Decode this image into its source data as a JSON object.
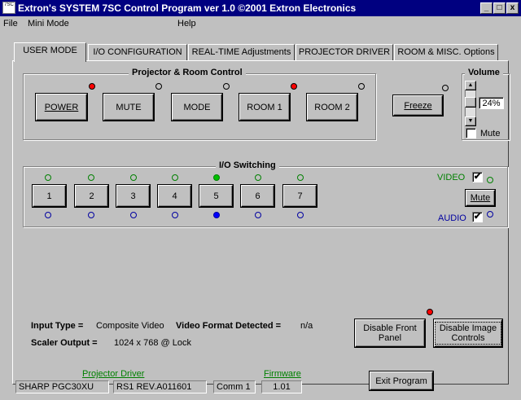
{
  "window": {
    "title": "Extron's SYSTEM 7SC Control Program    ver 1.0   ©2001 Extron Electronics",
    "icon_text": "7SC",
    "min_label": "_",
    "max_label": "□",
    "close_label": "x"
  },
  "menu": {
    "file": "File",
    "mini_mode": "Mini Mode",
    "help": "Help"
  },
  "tabs": [
    {
      "label": "USER MODE"
    },
    {
      "label": "I/O CONFIGURATION"
    },
    {
      "label": "REAL-TIME Adjustments"
    },
    {
      "label": "PROJECTOR DRIVER"
    },
    {
      "label": "ROOM & MISC. Options"
    }
  ],
  "projector_control": {
    "title": "Projector & Room Control",
    "buttons": [
      {
        "label": "POWER",
        "led": "red"
      },
      {
        "label": "MUTE",
        "led": "off"
      },
      {
        "label": "MODE",
        "led": "off"
      },
      {
        "label": "ROOM 1",
        "led": "red"
      },
      {
        "label": "ROOM 2",
        "led": "off"
      }
    ],
    "freeze_label": "Freeze",
    "freeze_led": "off"
  },
  "volume": {
    "title": "Volume",
    "value_text": "24%",
    "level": 0.24,
    "mute_label": "Mute",
    "mute_checked": false
  },
  "io_switching": {
    "title": "I/O Switching",
    "inputs": [
      "1",
      "2",
      "3",
      "4",
      "5",
      "6",
      "7"
    ],
    "active_input": "5",
    "video_label": "VIDEO",
    "audio_label": "AUDIO",
    "video_checked": true,
    "audio_checked": true,
    "check_mark": "✔",
    "mute_label": "Mute",
    "colors": {
      "video": "#008000",
      "audio": "#0000a0",
      "video_active": "#00c000",
      "audio_active": "#0000ff"
    }
  },
  "info": {
    "input_type_label": "Input Type =",
    "input_type_value": "Composite Video",
    "format_label": "Video Format Detected =",
    "format_value": "n/a",
    "scaler_label": "Scaler Output =",
    "scaler_value": "1024 x 768 @ Lock"
  },
  "panel_buttons": {
    "disable_front_panel": "Disable Front Panel",
    "disable_image_controls": "Disable Image Controls",
    "image_controls_led": "red"
  },
  "status": {
    "projector_driver_label": "Projector Driver",
    "projector_name": "SHARP PGC30XU",
    "driver_revision": "RS1 REV.A011601",
    "port": "Comm 1",
    "firmware_label": "Firmware",
    "firmware_version": "1.01",
    "exit_label": "Exit Program"
  }
}
